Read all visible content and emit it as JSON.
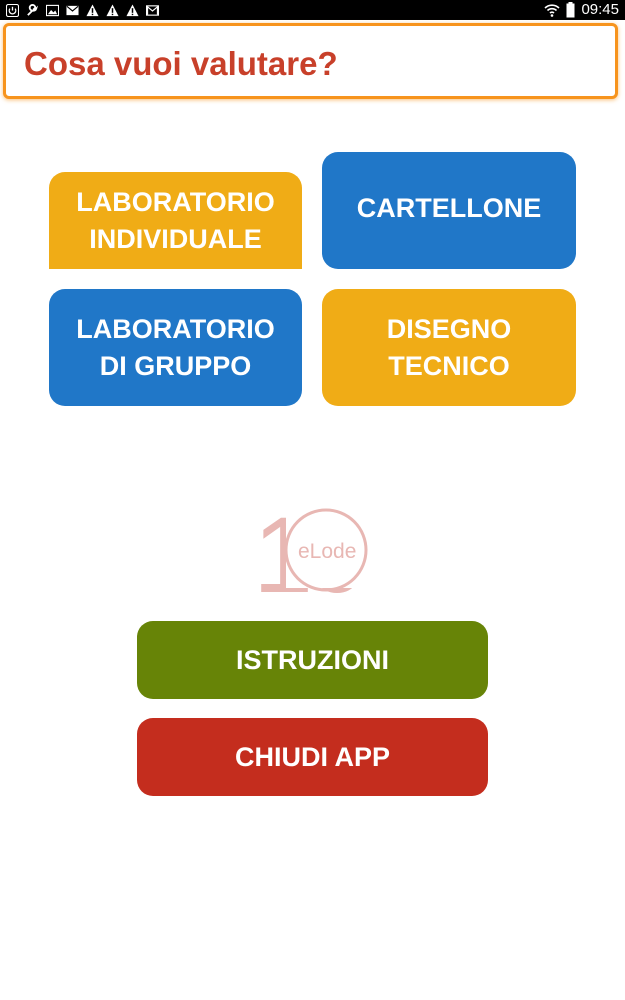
{
  "status_bar": {
    "time": "09:45",
    "left_icons": [
      "power-icon",
      "wrench-icon",
      "image-icon",
      "mail-icon",
      "warning-icon",
      "warning-icon",
      "warning-icon",
      "gmail-icon"
    ],
    "right_icons": [
      "wifi-icon",
      "battery-icon"
    ]
  },
  "header": {
    "title": "Cosa vuoi valutare?"
  },
  "tiles": [
    {
      "label": "LABORATORIO\nINDIVIDUALE",
      "color": "#f0ac16"
    },
    {
      "label": "CARTELLONE",
      "color": "#2077c8"
    },
    {
      "label": "LABORATORIO\nDI GRUPPO",
      "color": "#2077c8"
    },
    {
      "label": "DISEGNO\nTECNICO",
      "color": "#f0ac16"
    }
  ],
  "logo": {
    "number": "10",
    "text": "eLode"
  },
  "buttons": {
    "istruzioni": "ISTRUZIONI",
    "chiudi": "CHIUDI APP"
  },
  "colors": {
    "header_border": "#f7941d",
    "title": "#c8402a",
    "orange": "#f0ac16",
    "blue": "#2077c8",
    "green": "#678407",
    "red": "#c42d1e",
    "logo": "#e8b7b3"
  }
}
